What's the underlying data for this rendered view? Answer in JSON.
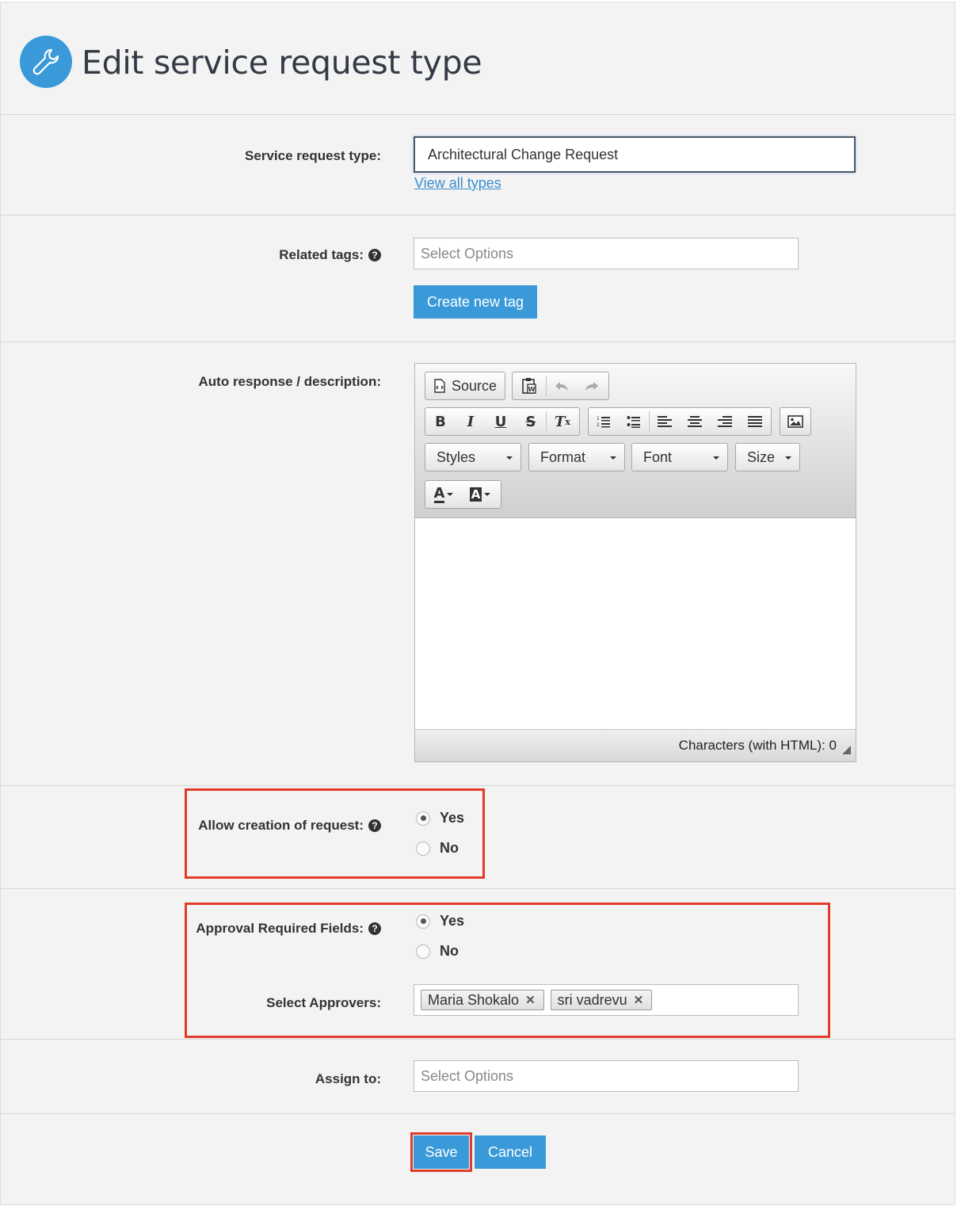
{
  "page": {
    "title": "Edit service request type",
    "icon": "wrench-icon",
    "accent_color": "#3a9ad9",
    "highlight_color": "#e23b2a"
  },
  "service_type": {
    "label": "Service request type:",
    "value": "Architectural Change Request",
    "view_all_link": "View all types"
  },
  "related_tags": {
    "label": "Related tags:",
    "placeholder": "Select Options",
    "create_button": "Create new tag"
  },
  "auto_response": {
    "label": "Auto response / description:",
    "toolbar": {
      "source_label": "Source",
      "styles_label": "Styles",
      "format_label": "Format",
      "font_label": "Font",
      "size_label": "Size"
    },
    "char_count_label": "Characters (with HTML): 0"
  },
  "allow_creation": {
    "label": "Allow creation of request:",
    "options": [
      "Yes",
      "No"
    ],
    "selected": "Yes"
  },
  "approval": {
    "label": "Approval Required Fields:",
    "options": [
      "Yes",
      "No"
    ],
    "selected": "Yes",
    "approvers_label": "Select Approvers:",
    "approvers": [
      "Maria Shokalo",
      "sri vadrevu"
    ]
  },
  "assign_to": {
    "label": "Assign to:",
    "placeholder": "Select Options"
  },
  "actions": {
    "save_label": "Save",
    "cancel_label": "Cancel"
  }
}
